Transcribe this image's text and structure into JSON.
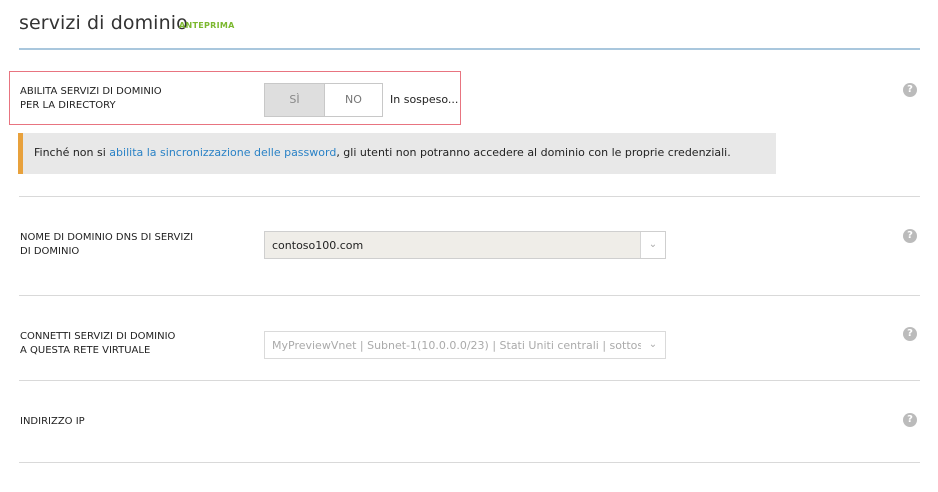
{
  "header": {
    "title": "servizi di dominio",
    "preview_tag": "ANTEPRIMA"
  },
  "enable_row": {
    "label_line1": "ABILITA SERVIZI DI DOMINIO",
    "label_line2": "PER LA DIRECTORY",
    "toggle_yes": "SÌ",
    "toggle_no": "NO",
    "status": "In sospeso...",
    "help_icon": "?"
  },
  "info_bar": {
    "text_before": "Finché non si ",
    "link_text": "abilita la sincronizzazione delle password",
    "text_after": ", gli utenti non potranno accedere al dominio con le proprie credenziali.",
    "accent_color": "#e8a13c"
  },
  "dns_row": {
    "label_line1": "NOME DI DOMINIO DNS DI SERVIZI",
    "label_line2": "DI DOMINIO",
    "value": "contoso100.com",
    "help_icon": "?"
  },
  "vnet_row": {
    "label_line1": "CONNETTI SERVIZI DI DOMINIO",
    "label_line2": "A QUESTA RETE VIRTUALE",
    "value": "MyPreviewVnet | Subnet-1(10.0.0.0/23) | Stati Uniti centrali | sottos...",
    "help_icon": "?"
  },
  "ip_row": {
    "label": "INDIRIZZO IP",
    "help_icon": "?"
  },
  "colors": {
    "header_line": "#a9c7dd",
    "highlight_border": "#e87480",
    "link": "#2a82c6",
    "preview_tag": "#7cb82f"
  }
}
